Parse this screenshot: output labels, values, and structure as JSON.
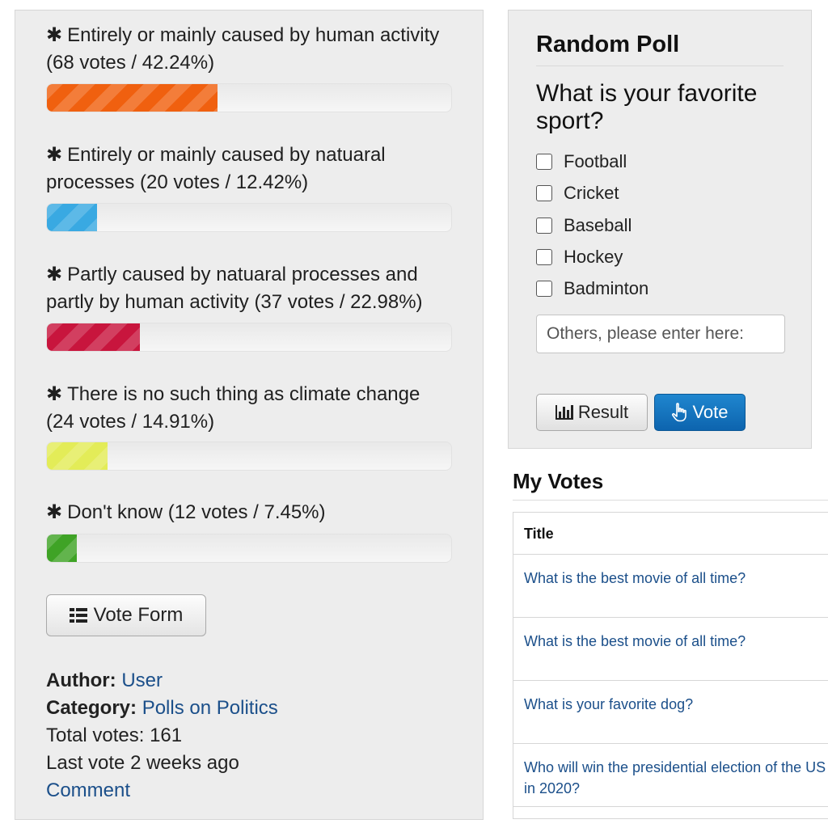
{
  "results": {
    "options": [
      {
        "text": "Entirely or mainly caused by human activity (68 votes / 42.24%)",
        "percent": 42.24,
        "color": "#f0600f"
      },
      {
        "text": "Entirely or mainly caused by natuaral processes (20 votes / 12.42%)",
        "percent": 12.42,
        "color": "#39a9e2"
      },
      {
        "text": "Partly caused by natuaral processes and partly by human activity (37 votes / 22.98%)",
        "percent": 22.98,
        "color": "#c8153d"
      },
      {
        "text": "There is no such thing as climate change (24 votes / 14.91%)",
        "percent": 14.91,
        "color": "#e3ec58"
      },
      {
        "text": "Don't know (12 votes / 7.45%)",
        "percent": 7.45,
        "color": "#3fa326"
      }
    ],
    "vote_form_label": "Vote Form",
    "author_label": "Author:",
    "author_value": "User",
    "category_label": "Category:",
    "category_value": "Polls on Politics",
    "total_votes": "Total votes: 161",
    "last_vote": "Last vote 2 weeks ago",
    "comment_label": "Comment"
  },
  "poll": {
    "heading": "Random Poll",
    "question": "What is your favorite sport?",
    "options": [
      "Football",
      "Cricket",
      "Baseball",
      "Hockey",
      "Badminton"
    ],
    "others_placeholder": "Others, please enter here:",
    "result_label": "Result",
    "vote_label": "Vote",
    "vote_color": "#1677c3"
  },
  "my_votes": {
    "heading": "My Votes",
    "column_title": "Title",
    "rows": [
      "What is the best movie of all time?",
      "What is the best movie of all time?",
      "What is your favorite dog?",
      "Who will win the presidential election of the US in 2020?"
    ]
  },
  "icons": {
    "asterisk": "✱",
    "list": "list-icon",
    "bar_chart": "bar-chart-icon",
    "hand_pointer": "hand-pointer-icon"
  }
}
